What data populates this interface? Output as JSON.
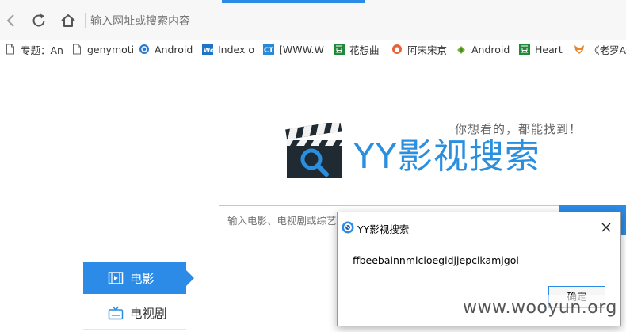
{
  "browser": {
    "address_placeholder": "输入网址或搜索内容",
    "bookmarks": [
      {
        "label": "专题：An",
        "icon": "page-icon"
      },
      {
        "label": "genymoti",
        "icon": "page-icon"
      },
      {
        "label": "Android",
        "icon": "android-dev-icon"
      },
      {
        "label": "Index o",
        "icon": "wo-icon"
      },
      {
        "label": "[WWW.W",
        "icon": "ct-icon"
      },
      {
        "label": "花想曲",
        "icon": "douban-icon"
      },
      {
        "label": "阿宋宋京",
        "icon": "weibo-icon"
      },
      {
        "label": "Android",
        "icon": "android-icon"
      },
      {
        "label": "Heart",
        "icon": "douban-icon"
      },
      {
        "label": "《老罗An",
        "icon": "fox-icon"
      }
    ]
  },
  "page": {
    "slogan": "你想看的，都能找到！",
    "logo_text": "YY影视搜索",
    "search_placeholder": "输入电影、电视剧或综艺节目",
    "tabs": [
      {
        "label": "电影",
        "active": true
      },
      {
        "label": "电视剧",
        "active": false
      }
    ]
  },
  "dialog": {
    "title": "YY影视搜索",
    "message": "ffbeebainnmlcloegidjjepclkamjgol",
    "ok_label": "确定"
  },
  "watermark": "www.wooyun.org",
  "colors": {
    "accent": "#2b8be6",
    "logo_blue": "#2b8fe0",
    "dark_icon": "#1f2a33"
  }
}
